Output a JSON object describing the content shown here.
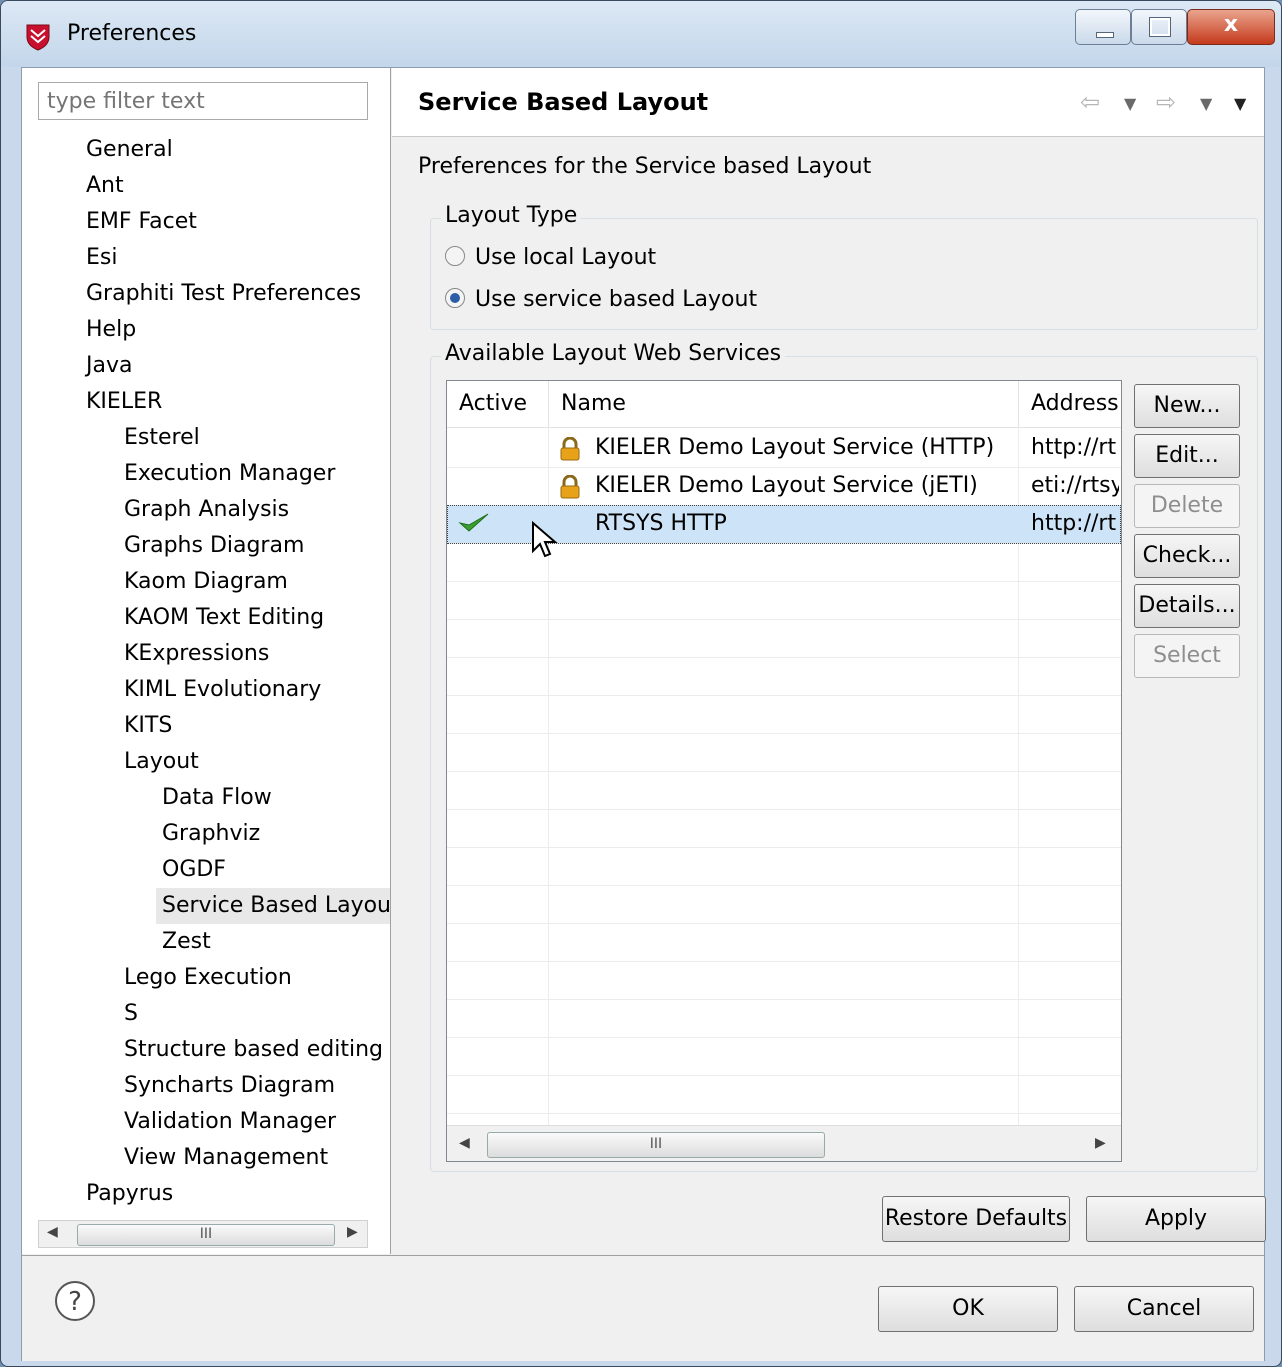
{
  "window": {
    "title": "Preferences",
    "controls": {
      "minimize": "",
      "maximize": "",
      "close": "x"
    }
  },
  "sidebar": {
    "filter_placeholder": "type filter text",
    "items": [
      {
        "label": "General",
        "level": 0
      },
      {
        "label": "Ant",
        "level": 0
      },
      {
        "label": "EMF Facet",
        "level": 0
      },
      {
        "label": "Esi",
        "level": 0
      },
      {
        "label": "Graphiti Test Preferences",
        "level": 0
      },
      {
        "label": "Help",
        "level": 0
      },
      {
        "label": "Java",
        "level": 0
      },
      {
        "label": "KIELER",
        "level": 0
      },
      {
        "label": "Esterel",
        "level": 1
      },
      {
        "label": "Execution Manager",
        "level": 1
      },
      {
        "label": "Graph Analysis",
        "level": 1
      },
      {
        "label": "Graphs Diagram",
        "level": 1
      },
      {
        "label": "Kaom Diagram",
        "level": 1
      },
      {
        "label": "KAOM Text Editing",
        "level": 1
      },
      {
        "label": "KExpressions",
        "level": 1
      },
      {
        "label": "KIML Evolutionary",
        "level": 1
      },
      {
        "label": "KITS",
        "level": 1
      },
      {
        "label": "Layout",
        "level": 1
      },
      {
        "label": "Data Flow",
        "level": 2
      },
      {
        "label": "Graphviz",
        "level": 2
      },
      {
        "label": "OGDF",
        "level": 2
      },
      {
        "label": "Service Based Layou",
        "level": 2,
        "selected": true
      },
      {
        "label": "Zest",
        "level": 2
      },
      {
        "label": "Lego Execution",
        "level": 1
      },
      {
        "label": "S",
        "level": 1
      },
      {
        "label": "Structure based editing",
        "level": 1
      },
      {
        "label": "Syncharts Diagram",
        "level": 1
      },
      {
        "label": "Validation Manager",
        "level": 1
      },
      {
        "label": "View Management",
        "level": 1
      },
      {
        "label": "Papyrus",
        "level": 0
      }
    ],
    "scroll_thumb": "III"
  },
  "page": {
    "title": "Service Based Layout",
    "description": "Preferences for the Service based Layout",
    "layout_type": {
      "label": "Layout Type",
      "options": [
        "Use local Layout",
        "Use service based Layout"
      ],
      "selected": "Use service based Layout"
    },
    "services": {
      "label": "Available Layout Web Services",
      "columns": [
        "Active",
        "Name",
        "Address"
      ],
      "rows": [
        {
          "active": false,
          "locked": true,
          "name": "KIELER Demo Layout Service (HTTP)",
          "address": "http://rt"
        },
        {
          "active": false,
          "locked": true,
          "name": "KIELER Demo Layout Service (jETI)",
          "address": "eti://rtsy"
        },
        {
          "active": true,
          "locked": false,
          "name": "RTSYS HTTP",
          "address": "http://rt",
          "selected": true
        }
      ],
      "scroll_thumb": "III",
      "buttons": [
        {
          "label": "New...",
          "enabled": true
        },
        {
          "label": "Edit...",
          "enabled": true
        },
        {
          "label": "Delete",
          "enabled": false
        },
        {
          "label": "Check...",
          "enabled": true
        },
        {
          "label": "Details...",
          "enabled": true
        },
        {
          "label": "Select",
          "enabled": false
        }
      ]
    },
    "restore_defaults": "Restore Defaults",
    "apply": "Apply"
  },
  "footer": {
    "help": "?",
    "ok": "OK",
    "cancel": "Cancel"
  },
  "colors": {
    "selection": "#cde3f7",
    "check": "#3aa02f",
    "lock": "#e8a21a"
  }
}
